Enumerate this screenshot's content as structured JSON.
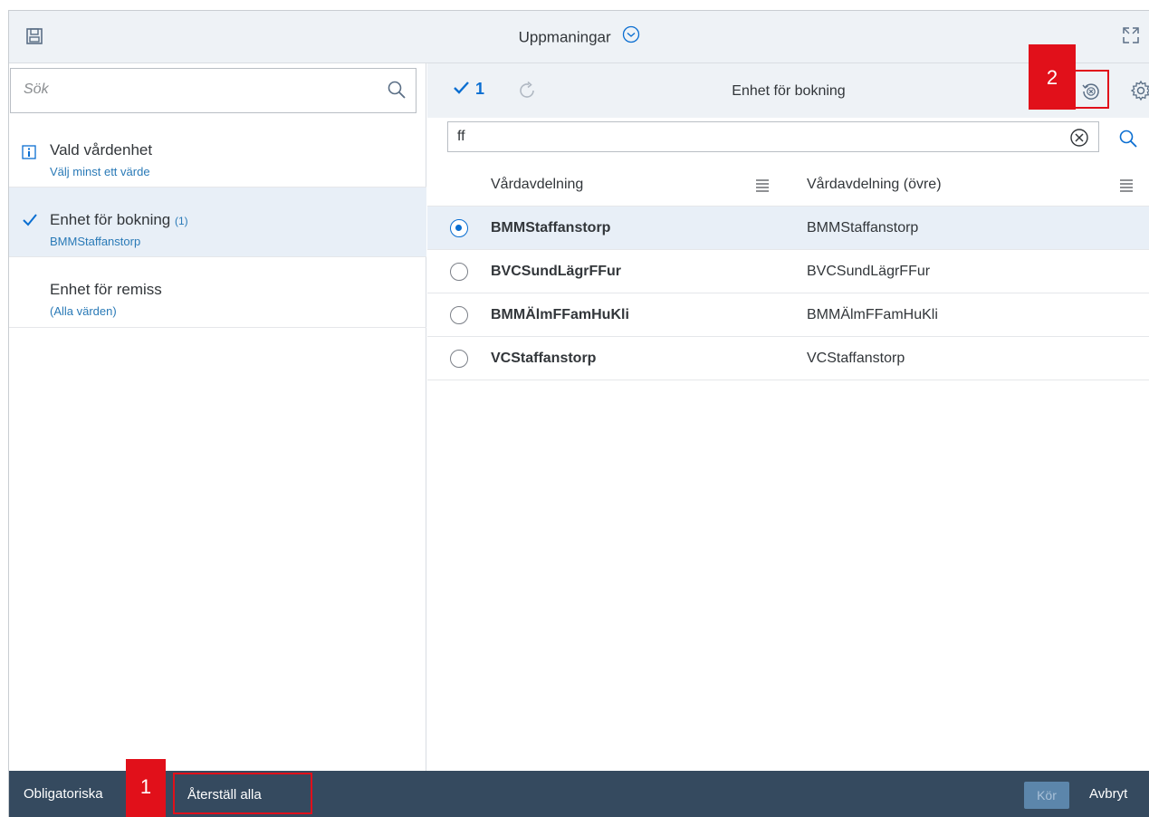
{
  "header": {
    "title": "Uppmaningar",
    "save_icon": "save-icon",
    "expand_icon": "expand-icon"
  },
  "left": {
    "search": {
      "placeholder": "Sök"
    },
    "prompts": [
      {
        "label": "Vald vårdenhet",
        "count": "",
        "sub": "Välj minst ett värde",
        "icon": "info-icon"
      },
      {
        "label": "Enhet för bokning",
        "count": "(1)",
        "sub": "BMMStaffanstorp",
        "icon": "check-icon"
      },
      {
        "label": "Enhet för remiss",
        "count": "",
        "sub": "(Alla värden)",
        "icon": ""
      }
    ]
  },
  "right": {
    "toolbar": {
      "selected_count": "1",
      "title": "Enhet för bokning"
    },
    "filter": {
      "value": "ff"
    },
    "table": {
      "columns": [
        "Vårdavdelning",
        "Vårdavdelning (övre)"
      ],
      "rows": [
        {
          "c1": "BMMStaffanstorp",
          "c2": "BMMStaffanstorp",
          "selected": true
        },
        {
          "c1": "BVCSundLägrFFur",
          "c2": "BVCSundLägrFFur",
          "selected": false
        },
        {
          "c1": "BMMÄlmFFamHuKli",
          "c2": "BMMÄlmFFamHuKli",
          "selected": false
        },
        {
          "c1": "VCStaffanstorp",
          "c2": "VCStaffanstorp",
          "selected": false
        }
      ]
    }
  },
  "footer": {
    "mandatory": "Obligatoriska",
    "reset_all": "Återställ alla",
    "run": "Kör",
    "cancel": "Avbryt"
  },
  "callouts": [
    "1",
    "2"
  ],
  "colors": {
    "accent": "#0a6ed1",
    "footer_bg": "#354a5f",
    "callout": "#e1101a",
    "selected_row": "#e8eff7"
  }
}
